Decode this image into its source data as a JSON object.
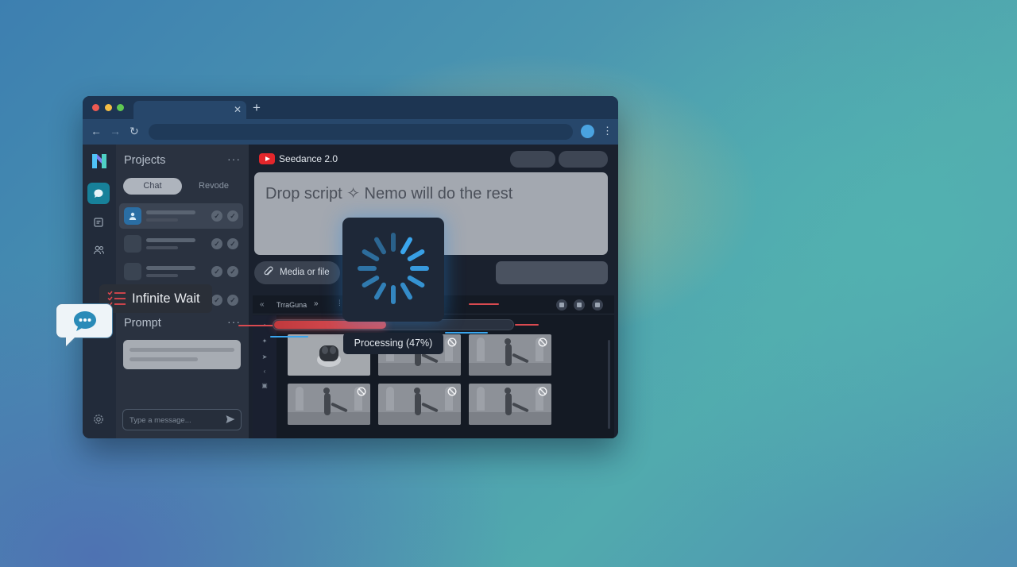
{
  "sidebar": {
    "title": "Projects",
    "more": "···",
    "segments": [
      "Chat",
      "Revode"
    ],
    "prompt_title": "Prompt",
    "prompt_more": "···",
    "message_placeholder": "Type a message..."
  },
  "main": {
    "app_name": "Seedance 2.0",
    "dropzone_text": "Drop script ✧ Nemo will do the rest",
    "media_button": "Media or file"
  },
  "editor": {
    "track_label": "TrraGuna",
    "prev_glyph": "«",
    "ffwd_glyph": "»"
  },
  "processing": {
    "label": "Processing (47%)",
    "progress": 0.47
  },
  "badge": {
    "label": "Infinite Wait"
  },
  "colors": {
    "accent": "#17819a",
    "progress": "#e1545a",
    "spinner": "#3aa6ee"
  },
  "icons": [
    "chat-icon",
    "clipboard-icon",
    "users-icon",
    "gear-icon",
    "send-icon",
    "paperclip-icon",
    "spinner-icon",
    "blocked-icon",
    "checklist-icon",
    "speech-bubble-icon"
  ]
}
